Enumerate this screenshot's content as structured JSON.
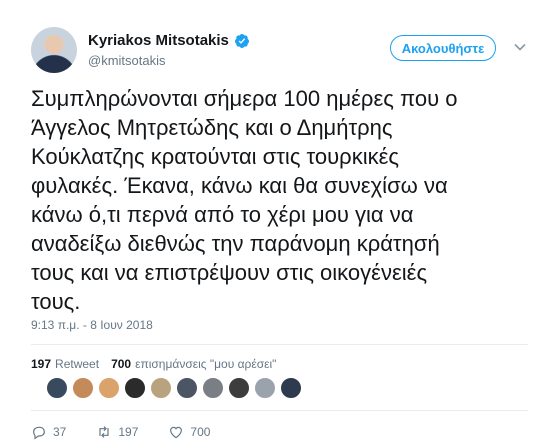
{
  "author": {
    "name": "Kyriakos Mitsotakis",
    "handle": "@kmitsotakis"
  },
  "follow_button": {
    "label": "Ακολουθήστε"
  },
  "tweet": {
    "text": "Συμπληρώνονται σήμερα 100 ημέρες που ο\nΆγγελος Μητρετώδης και ο Δημήτρης\nΚούκλατζης κρατούνται στις τουρκικές\nφυλακές. Έκανα, κάνω και θα συνεχίσω να\nκάνω ό,τι περνά από το χέρι μου για να\nαναδείξω διεθνώς την παράνομη κράτησή\nτους και να επιστρέψουν στις οικογένειές\nτους.",
    "timestamp": "9:13 π.μ. - 8 Ιουν 2018"
  },
  "stats": {
    "retweets": "197",
    "retweets_label": "Retweet",
    "likes": "700",
    "likes_label": "επισημάνσεις \"μου αρέσει\""
  },
  "likers": [
    "#3a4a5e",
    "#c58a5a",
    "#d9a36b",
    "#2b2b2b",
    "#b9a37e",
    "#4b5563",
    "#7a7f86",
    "#3d3d3d",
    "#9aa3ad",
    "#2e3b4e"
  ],
  "actions": {
    "reply_count": "37",
    "retweet_count": "197",
    "like_count": "700"
  },
  "colors": {
    "accent": "#1da1f2",
    "secondary_text": "#657786",
    "primary_text": "#14171a"
  }
}
